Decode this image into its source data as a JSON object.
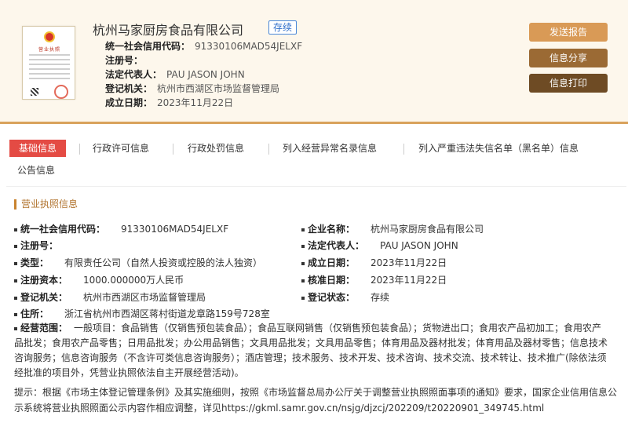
{
  "header": {
    "company_name": "杭州马家厨房食品有限公司",
    "status_badge": "存续",
    "rows": [
      {
        "label": "统一社会信用代码：",
        "value": "91330106MAD54JELXF"
      },
      {
        "label": "注册号：",
        "value": ""
      },
      {
        "label": "法定代表人：",
        "value": "PAU JASON JOHN"
      },
      {
        "label": "登记机关：",
        "value": "杭州市西湖区市场监督管理局"
      },
      {
        "label": "成立日期：",
        "value": "2023年11月22日"
      }
    ],
    "buttons": {
      "report": "发送报告",
      "share": "信息分享",
      "print": "信息打印"
    }
  },
  "license_thumb": {
    "title": "营业执照"
  },
  "tabs": [
    "基础信息",
    "行政许可信息",
    "行政处罚信息",
    "列入经营异常名录信息",
    "列入严重违法失信名单（黑名单）信息",
    "公告信息"
  ],
  "section": {
    "title": "营业执照信息"
  },
  "fields_left": [
    {
      "label": "统一社会信用代码：",
      "value": "91330106MAD54JELXF"
    },
    {
      "label": "注册号：",
      "value": ""
    },
    {
      "label": "类型：",
      "value": "有限责任公司（自然人投资或控股的法人独资）"
    },
    {
      "label": "注册资本：",
      "value": "1000.000000万人民币"
    },
    {
      "label": "登记机关：",
      "value": "杭州市西湖区市场监督管理局"
    },
    {
      "label": "住所：",
      "value": "浙江省杭州市西湖区蒋村街道龙章路159号728室"
    }
  ],
  "fields_right": [
    {
      "label": "企业名称：",
      "value": "杭州马家厨房食品有限公司"
    },
    {
      "label": "法定代表人：",
      "value": "PAU JASON JOHN"
    },
    {
      "label": "成立日期：",
      "value": "2023年11月22日"
    },
    {
      "label": "核准日期：",
      "value": "2023年11月22日"
    },
    {
      "label": "登记状态：",
      "value": "存续"
    }
  ],
  "scope": {
    "label": "经营范围：",
    "value": "一般项目：食品销售（仅销售预包装食品）；食品互联网销售（仅销售预包装食品）；货物进出口；食用农产品初加工；食用农产品批发；食用农产品零售；日用品批发；办公用品销售；文具用品批发；文具用品零售；体育用品及器材批发；体育用品及器材零售；信息技术咨询服务；信息咨询服务（不含许可类信息咨询服务）；酒店管理；技术服务、技术开发、技术咨询、技术交流、技术转让、技术推广(除依法须经批准的项目外，凭营业执照依法自主开展经营活动)。"
  },
  "tip": "提示：根据《市场主体登记管理条例》及其实施细则，按照《市场监督总局办公厅关于调整营业执照照面事项的通知》要求，国家企业信用信息公示系统将营业执照照面公示内容作相应调整，详见https://gkml.samr.gov.cn/nsjg/djzcj/202209/t20220901_349745.html"
}
